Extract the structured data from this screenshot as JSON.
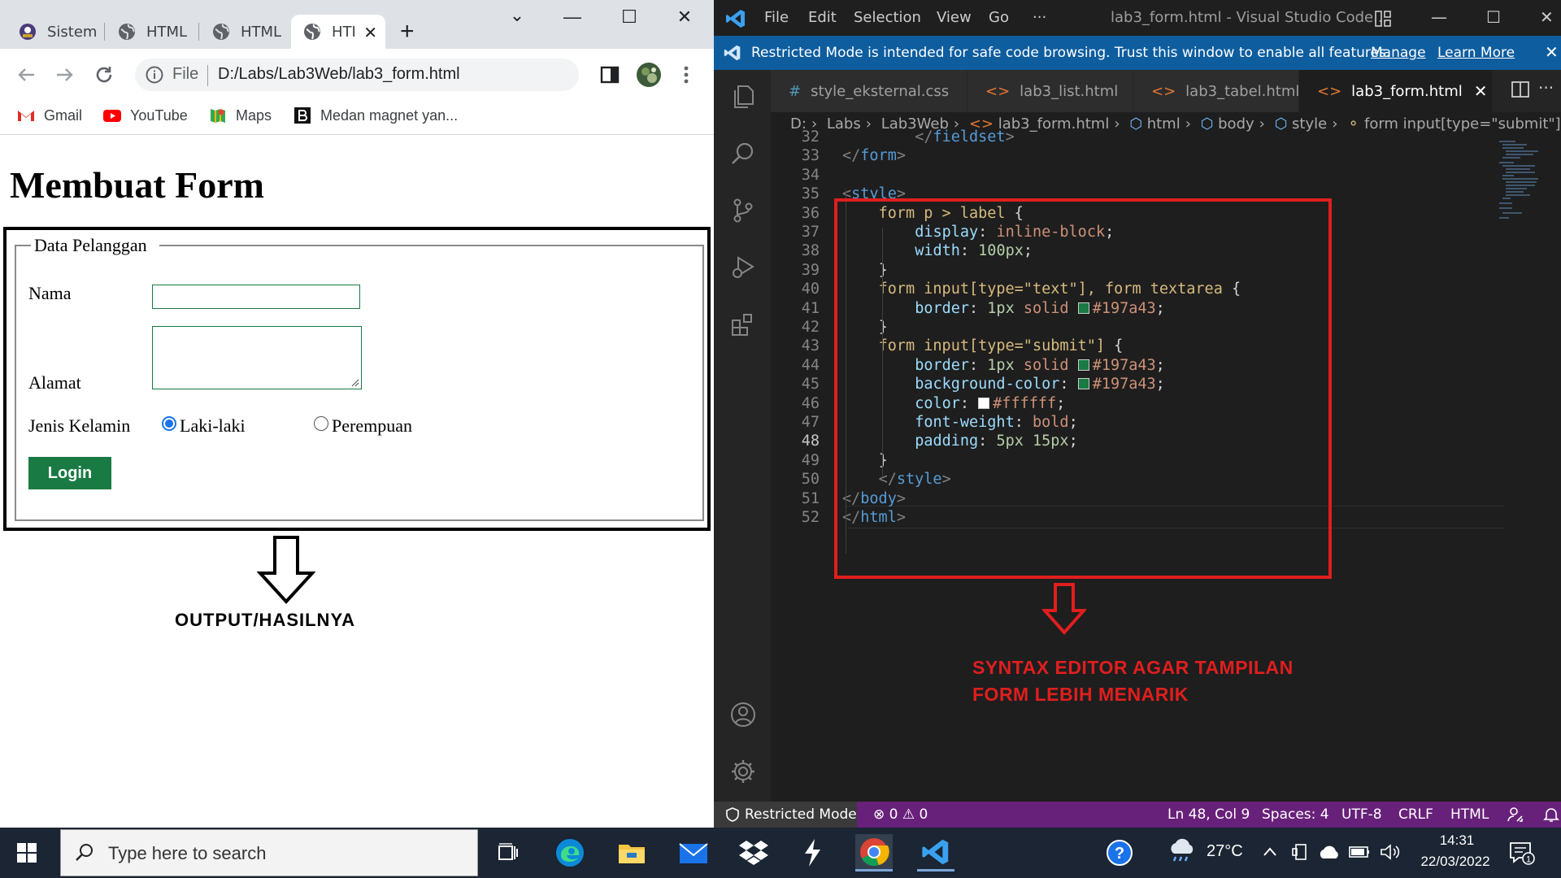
{
  "chrome": {
    "tabs": [
      {
        "label": "Sistem",
        "icon": "app-logo-icon"
      },
      {
        "label": "HTML",
        "icon": "globe-icon"
      },
      {
        "label": "HTML",
        "icon": "globe-icon"
      },
      {
        "label": "HTI",
        "icon": "globe-icon",
        "active": true
      }
    ],
    "new_tab": "+",
    "window_controls": {
      "dropdown": "⌄",
      "minimize": "—",
      "maximize": "☐",
      "close": "✕"
    },
    "tab_close": "✕",
    "address": {
      "scheme_label": "File",
      "url": "D:/Labs/Lab3Web/lab3_form.html"
    },
    "bookmarks": [
      {
        "label": "Gmail",
        "icon": "gmail-icon"
      },
      {
        "label": "YouTube",
        "icon": "youtube-icon"
      },
      {
        "label": "Maps",
        "icon": "maps-icon"
      },
      {
        "label": "Medan magnet yan...",
        "icon": "bookmark-b-icon"
      }
    ]
  },
  "page": {
    "heading": "Membuat Form",
    "legend": "Data Pelanggan",
    "labels": {
      "nama": "Nama",
      "alamat": "Alamat",
      "jenis_kelamin": "Jenis Kelamin"
    },
    "radios": [
      {
        "label": "Laki-laki",
        "checked": true
      },
      {
        "label": "Perempuan",
        "checked": false
      }
    ],
    "submit_label": "Login",
    "accent_color": "#197a43",
    "output_caption": "OUTPUT/HASILNYA"
  },
  "vscode": {
    "menu": [
      "File",
      "Edit",
      "Selection",
      "View",
      "Go",
      "···"
    ],
    "title": "lab3_form.html - Visual Studio Code...",
    "window_controls": {
      "minimize": "—",
      "maximize": "☐",
      "close": "✕"
    },
    "banner": {
      "text": "Restricted Mode is intended for safe code browsing. Trust this window to enable all features.",
      "manage": "Manage",
      "learn_more": "Learn More",
      "close": "✕"
    },
    "tabs": [
      {
        "label": "style_eksternal.css",
        "icon": "#"
      },
      {
        "label": "lab3_list.html",
        "icon": "<>"
      },
      {
        "label": "lab3_tabel.html",
        "icon": "<>"
      },
      {
        "label": "lab3_form.html",
        "icon": "<>",
        "active": true
      }
    ],
    "more": "···",
    "breadcrumb": [
      "D:",
      "Labs",
      "Lab3Web",
      "lab3_form.html",
      "html",
      "body",
      "style",
      "form input[type=\"submit\"]"
    ],
    "code_lines": [
      {
        "n": "32",
        "tokens": [
          [
            "p",
            "</"
          ],
          [
            "t",
            "fieldset"
          ],
          [
            "p",
            ">"
          ]
        ],
        "indent": 2
      },
      {
        "n": "33",
        "tokens": [
          [
            "p",
            "</"
          ],
          [
            "t",
            "form"
          ],
          [
            "p",
            ">"
          ]
        ],
        "indent": 0
      },
      {
        "n": "34",
        "tokens": [],
        "indent": 0
      },
      {
        "n": "35",
        "tokens": [
          [
            "p",
            "<"
          ],
          [
            "t",
            "style"
          ],
          [
            "p",
            ">"
          ]
        ],
        "indent": 0
      },
      {
        "n": "36",
        "tokens": [
          [
            "s",
            "form p > label"
          ],
          [
            "x",
            " {"
          ]
        ],
        "indent": 1
      },
      {
        "n": "37",
        "tokens": [
          [
            "k",
            "display"
          ],
          [
            "x",
            ": "
          ],
          [
            "v",
            "inline-block"
          ],
          [
            "x",
            ";"
          ]
        ],
        "indent": 2
      },
      {
        "n": "38",
        "tokens": [
          [
            "k",
            "width"
          ],
          [
            "x",
            ": "
          ],
          [
            "n",
            "100px"
          ],
          [
            "x",
            ";"
          ]
        ],
        "indent": 2
      },
      {
        "n": "39",
        "tokens": [
          [
            "x",
            "}"
          ]
        ],
        "indent": 1
      },
      {
        "n": "40",
        "tokens": [
          [
            "s",
            "form input[type=\"text\"], form textarea"
          ],
          [
            "x",
            " {"
          ]
        ],
        "indent": 1
      },
      {
        "n": "41",
        "tokens": [
          [
            "k",
            "border"
          ],
          [
            "x",
            ": "
          ],
          [
            "n",
            "1px"
          ],
          [
            "x",
            " "
          ],
          [
            "v",
            "solid"
          ],
          [
            "x",
            " "
          ],
          [
            "c",
            "#197a43"
          ],
          [
            "v",
            "#197a43"
          ],
          [
            "x",
            ";"
          ]
        ],
        "indent": 2
      },
      {
        "n": "42",
        "tokens": [
          [
            "x",
            "}"
          ]
        ],
        "indent": 1
      },
      {
        "n": "43",
        "tokens": [
          [
            "s",
            "form input[type=\"submit\"]"
          ],
          [
            "x",
            " {"
          ]
        ],
        "indent": 1
      },
      {
        "n": "44",
        "tokens": [
          [
            "k",
            "border"
          ],
          [
            "x",
            ": "
          ],
          [
            "n",
            "1px"
          ],
          [
            "x",
            " "
          ],
          [
            "v",
            "solid"
          ],
          [
            "x",
            " "
          ],
          [
            "c",
            "#197a43"
          ],
          [
            "v",
            "#197a43"
          ],
          [
            "x",
            ";"
          ]
        ],
        "indent": 2
      },
      {
        "n": "45",
        "tokens": [
          [
            "k",
            "background-color"
          ],
          [
            "x",
            ": "
          ],
          [
            "c",
            "#197a43"
          ],
          [
            "v",
            "#197a43"
          ],
          [
            "x",
            ";"
          ]
        ],
        "indent": 2
      },
      {
        "n": "46",
        "tokens": [
          [
            "k",
            "color"
          ],
          [
            "x",
            ": "
          ],
          [
            "c",
            "#ffffff"
          ],
          [
            "v",
            "#ffffff"
          ],
          [
            "x",
            ";"
          ]
        ],
        "indent": 2
      },
      {
        "n": "47",
        "tokens": [
          [
            "k",
            "font-weight"
          ],
          [
            "x",
            ": "
          ],
          [
            "v",
            "bold"
          ],
          [
            "x",
            ";"
          ]
        ],
        "indent": 2
      },
      {
        "n": "48",
        "tokens": [
          [
            "k",
            "padding"
          ],
          [
            "x",
            ": "
          ],
          [
            "n",
            "5px"
          ],
          [
            "x",
            " "
          ],
          [
            "n",
            "15px"
          ],
          [
            "x",
            ";"
          ]
        ],
        "indent": 2,
        "current": true
      },
      {
        "n": "49",
        "tokens": [
          [
            "x",
            "}"
          ]
        ],
        "indent": 1
      },
      {
        "n": "50",
        "tokens": [
          [
            "p",
            "</"
          ],
          [
            "t",
            "style"
          ],
          [
            "p",
            ">"
          ]
        ],
        "indent": 1
      },
      {
        "n": "51",
        "tokens": [
          [
            "p",
            "</"
          ],
          [
            "t",
            "body"
          ],
          [
            "p",
            ">"
          ]
        ],
        "indent": 0
      },
      {
        "n": "52",
        "tokens": [
          [
            "p",
            "</"
          ],
          [
            "t",
            "html"
          ],
          [
            "p",
            ">"
          ]
        ],
        "indent": 0
      }
    ],
    "annotation_line1": "SYNTAX EDITOR AGAR TAMPILAN",
    "annotation_line2": "FORM LEBIH MENARIK",
    "annotation_color": "#e01e1e",
    "status": {
      "restricted": "Restricted Mode",
      "problems": "⊗ 0 ⚠ 0",
      "position": "Ln 48, Col 9",
      "spaces": "Spaces: 4",
      "encoding": "UTF-8",
      "eol": "CRLF",
      "language": "HTML"
    }
  },
  "taskbar": {
    "search_placeholder": "Type here to search",
    "apps": [
      "task-view-icon",
      "edge-icon",
      "file-explorer-icon",
      "mail-icon",
      "dropbox-icon",
      "bolt-app-icon",
      "chrome-icon",
      "vscode-icon"
    ],
    "temperature": "27°C",
    "time": "14:31",
    "date": "22/03/2022",
    "notifications": "1"
  }
}
